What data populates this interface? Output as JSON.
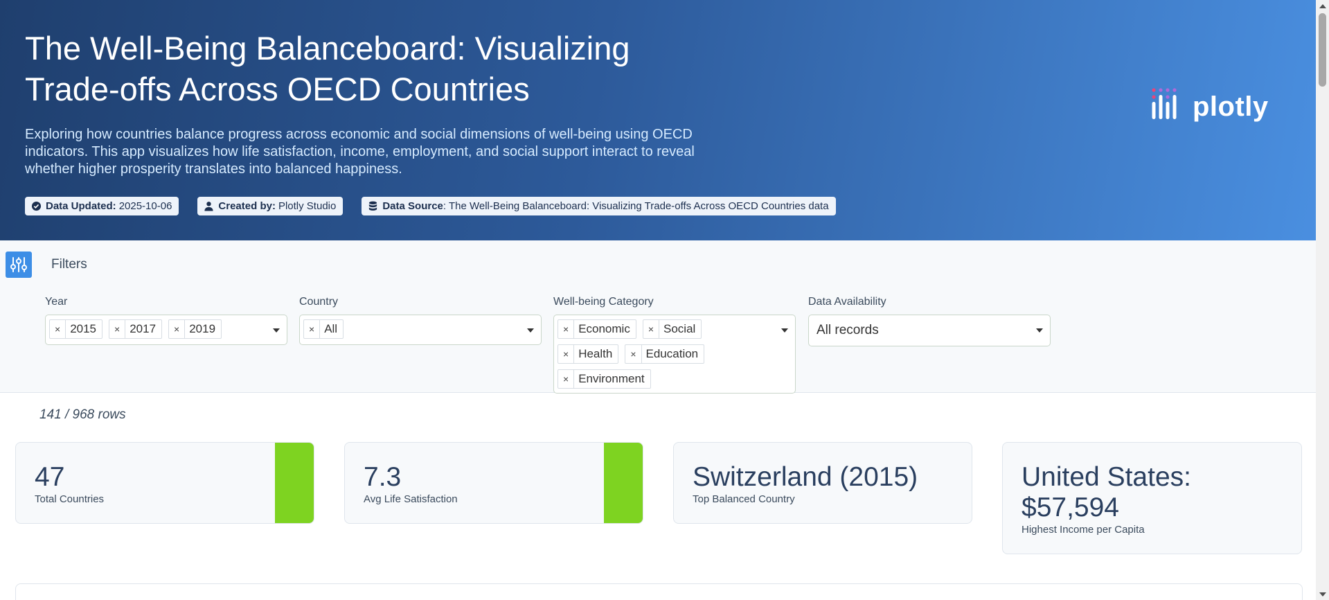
{
  "header": {
    "title": "The Well-Being Balanceboard: Visualizing Trade-offs Across OECD Countries",
    "subtitle": "Exploring how countries balance progress across economic and social dimensions of well-being using OECD indicators. This app visualizes how life satisfaction, income, employment, and social support interact to reveal whether higher prosperity translates into balanced happiness.",
    "badges": [
      {
        "icon": "check-circle-icon",
        "label": "Data Updated:",
        "value": "2025-10-06"
      },
      {
        "icon": "user-icon",
        "label": "Created by:",
        "value": "Plotly Studio"
      },
      {
        "icon": "database-icon",
        "label": "Data Source",
        "value": ": The Well-Being Balanceboard: Visualizing Trade-offs Across OECD Countries data"
      }
    ],
    "logo_text": "plotly"
  },
  "filters": {
    "label": "Filters",
    "year": {
      "label": "Year",
      "chips": [
        "2015",
        "2017",
        "2019"
      ]
    },
    "country": {
      "label": "Country",
      "chips": [
        "All"
      ]
    },
    "category": {
      "label": "Well-being Category",
      "chips": [
        "Economic",
        "Social",
        "Health",
        "Education",
        "Environment"
      ]
    },
    "availability": {
      "label": "Data Availability",
      "value": "All records"
    }
  },
  "row_count": "141 / 968 rows",
  "kpis": [
    {
      "value": "47",
      "caption": "Total Countries"
    },
    {
      "value": "7.3",
      "caption": "Avg Life Satisfaction"
    },
    {
      "value": "Switzerland (2015)",
      "caption": "Top Balanced Country"
    },
    {
      "value": "United States: $57,594",
      "caption": "Highest Income per Capita"
    }
  ],
  "colors": {
    "accent_green": "#7ed321",
    "header_dark": "#1f3f6e",
    "header_light": "#4a8fe0",
    "filter_button": "#3d8ee6"
  }
}
